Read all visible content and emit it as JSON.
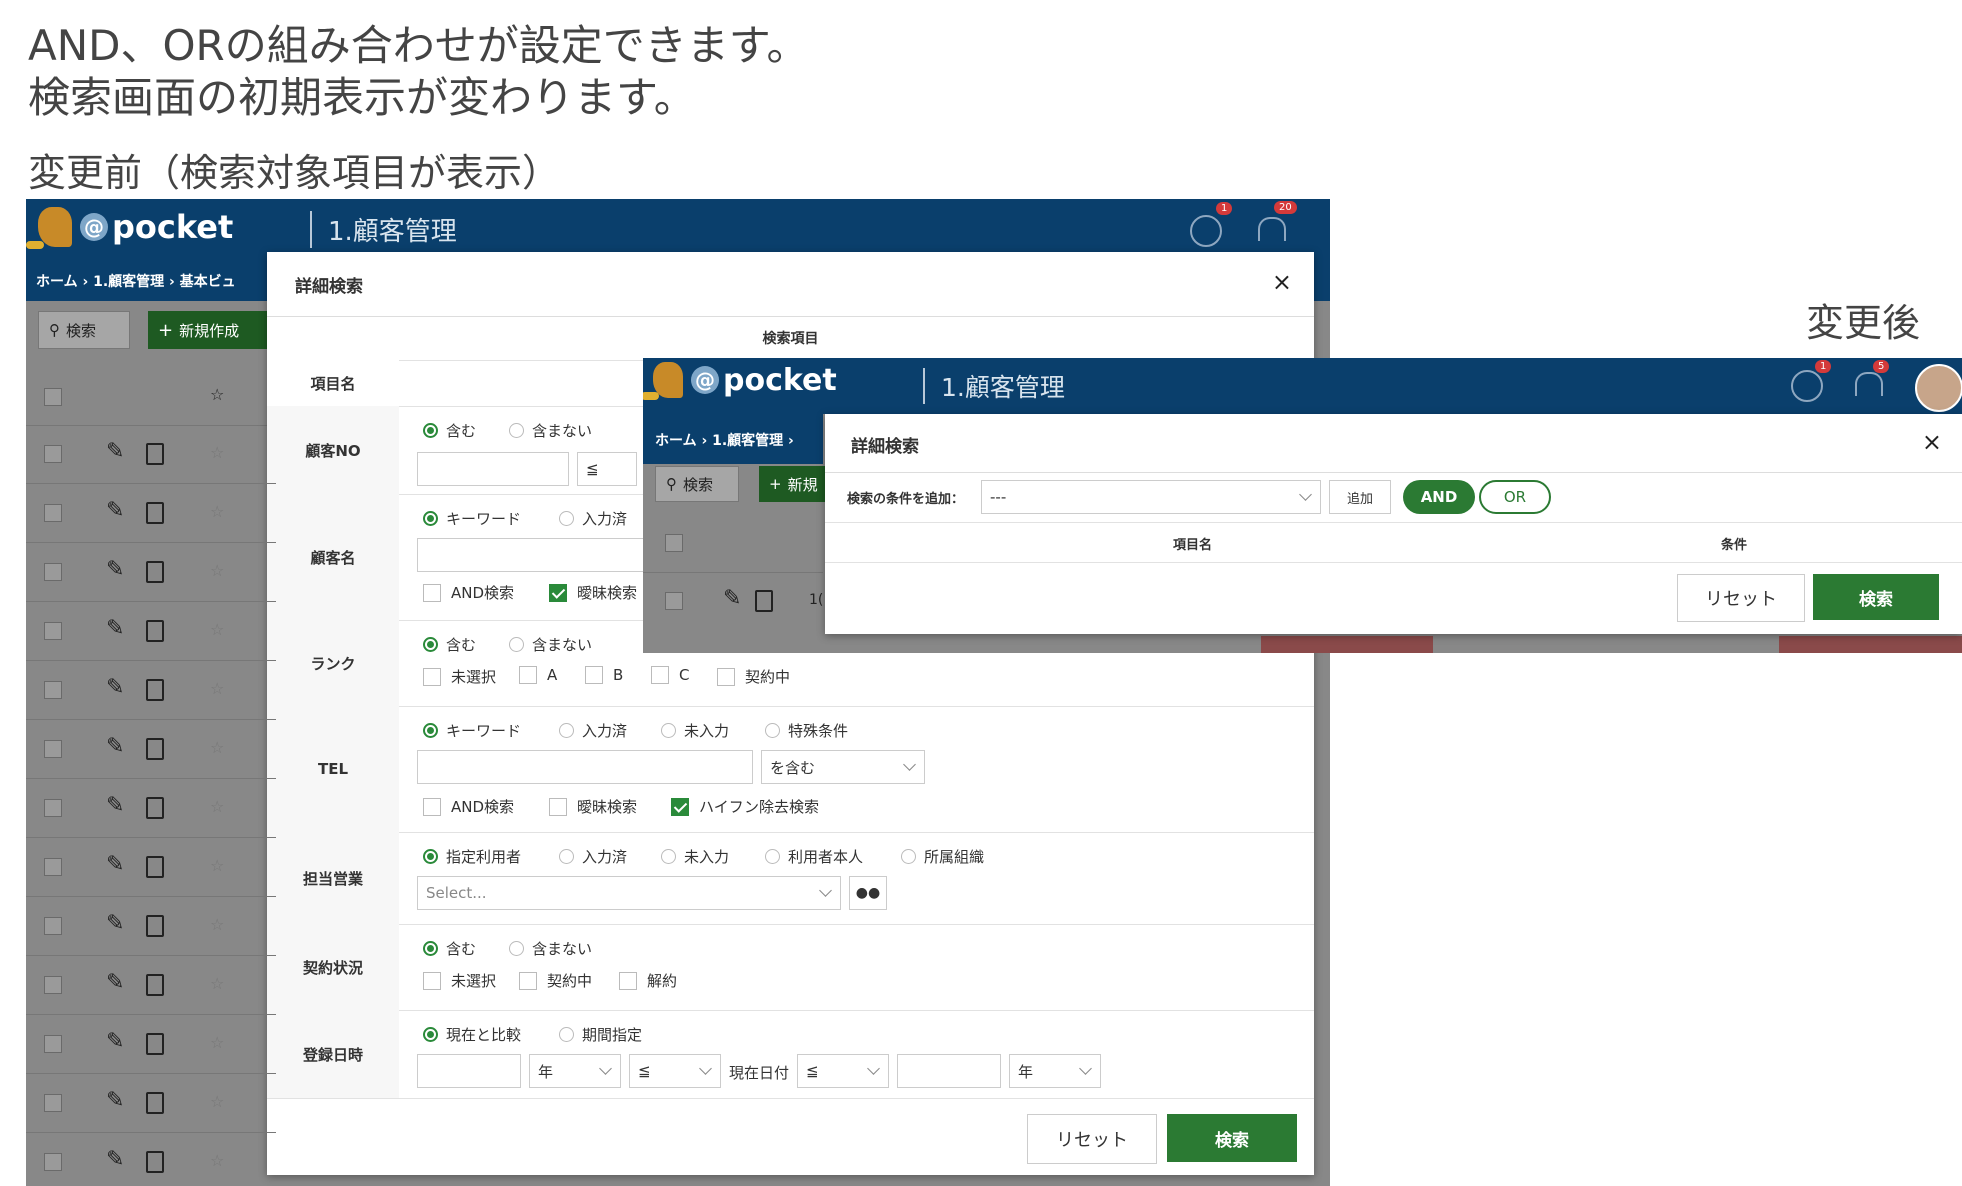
{
  "headings": {
    "line1": "AND、ORの組み合わせが設定できます。",
    "line2": "検索画面の初期表示が変わります。",
    "before_label": "変更前（検索対象項目が表示）",
    "after_label": "変更後"
  },
  "app": {
    "brand": "pocket",
    "title": "1.顧客管理",
    "notif_count": "1",
    "bell_count": "20",
    "bell_count_after": "5"
  },
  "breadcrumb_before": "ホーム  ›  1.顧客管理  ›  基本ビュ",
  "breadcrumb_after": "ホーム  ›  1.顧客管理  ›",
  "toolbar": {
    "search": "検索",
    "new_before": "新規作成",
    "new_after": "新規"
  },
  "grid_cell": "1(",
  "before_modal": {
    "title": "詳細検索",
    "close": "×",
    "section_header": "検索項目",
    "item_name_label": "項目名",
    "rows": {
      "customer_no": {
        "label": "顧客NO",
        "opt1": "含む",
        "opt2": "含まない",
        "op": "≦"
      },
      "customer_name": {
        "label": "顧客名",
        "opt1": "キーワード",
        "opt2": "入力済",
        "and_search": "AND検索",
        "fuzzy": "曖昧検索"
      },
      "rank": {
        "label": "ランク",
        "opt1": "含む",
        "opt2": "含まない",
        "c1": "未選択",
        "c2": "A",
        "c3": "B",
        "c4": "C",
        "c5": "契約中"
      },
      "tel": {
        "label": "TEL",
        "opt1": "キーワード",
        "opt2": "入力済",
        "opt3": "未入力",
        "opt4": "特殊条件",
        "match": "を含む",
        "and_search": "AND検索",
        "fuzzy": "曖昧検索",
        "hyphen": "ハイフン除去検索"
      },
      "sales": {
        "label": "担当営業",
        "opt1": "指定利用者",
        "opt2": "入力済",
        "opt3": "未入力",
        "opt4": "利用者本人",
        "opt5": "所属組織",
        "select_placeholder": "Select..."
      },
      "contract": {
        "label": "契約状況",
        "opt1": "含む",
        "opt2": "含まない",
        "c1": "未選択",
        "c2": "契約中",
        "c3": "解約"
      },
      "registered": {
        "label": "登録日時",
        "opt1": "現在と比較",
        "opt2": "期間指定",
        "year1": "年",
        "op1": "≦",
        "today": "現在日付",
        "op2": "≦",
        "year2": "年"
      }
    },
    "reset": "リセット",
    "search": "検索"
  },
  "after_modal": {
    "title": "詳細検索",
    "close": "×",
    "add_label": "検索の条件を追加：",
    "add_select": "---",
    "add_button": "追加",
    "and": "AND",
    "or": "OR",
    "col_item": "項目名",
    "col_condition": "条件",
    "reset": "リセット",
    "search": "検索"
  },
  "colors": {
    "navy": "#0a3f6c",
    "green": "#2b7a33",
    "badge": "#d43a3a"
  }
}
